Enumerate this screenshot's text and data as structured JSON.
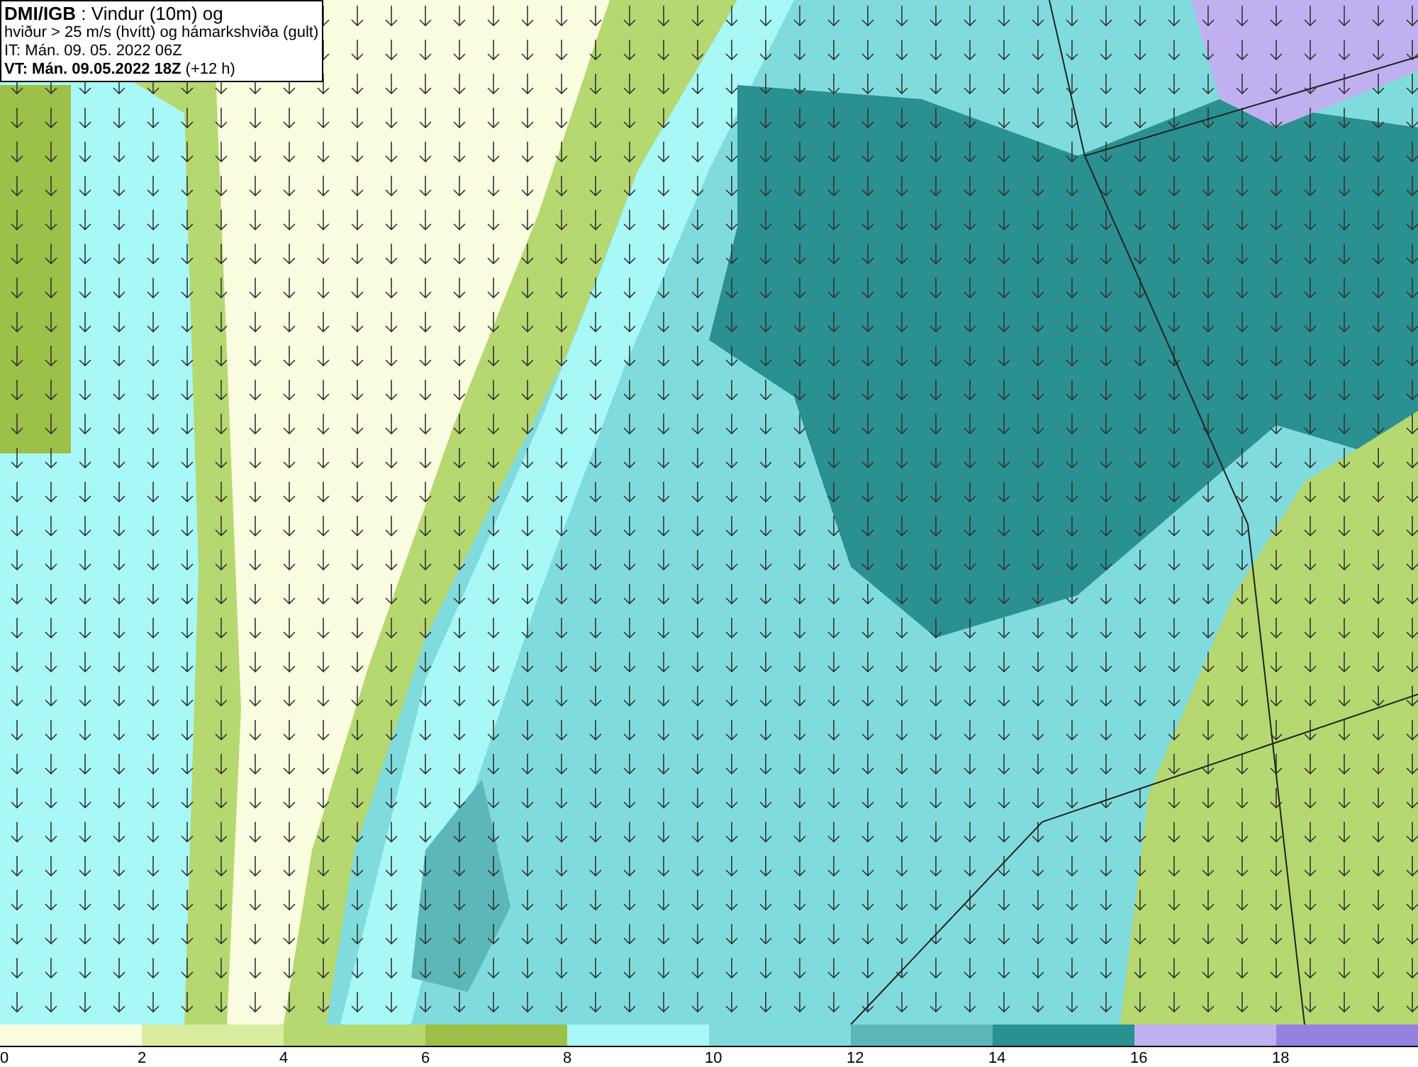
{
  "header": {
    "lines": [
      "**DMI/IGB** : Vindur (10m) og",
      "hviður > 25 m/s (hvítt) og hámarkshviða (gult)",
      "IT: Mán. 09. 05. 2022 06Z",
      "**VT: Mán. 09.05.2022 18Z** (+12 h)"
    ]
  },
  "legend": {
    "bins": [
      {
        "color": "#fafde0"
      },
      {
        "color": "#d8eda0"
      },
      {
        "color": "#b6d870"
      },
      {
        "color": "#9cc048"
      },
      {
        "color": "#a8f8f8"
      },
      {
        "color": "#80dcdc"
      },
      {
        "color": "#5cb8b8"
      },
      {
        "color": "#2a9090"
      },
      {
        "color": "#c0b0f0"
      },
      {
        "color": "#9880e0"
      }
    ],
    "ticks": [
      "0",
      "2",
      "4",
      "6",
      "8",
      "10",
      "12",
      "14",
      "16",
      "18"
    ]
  }
}
